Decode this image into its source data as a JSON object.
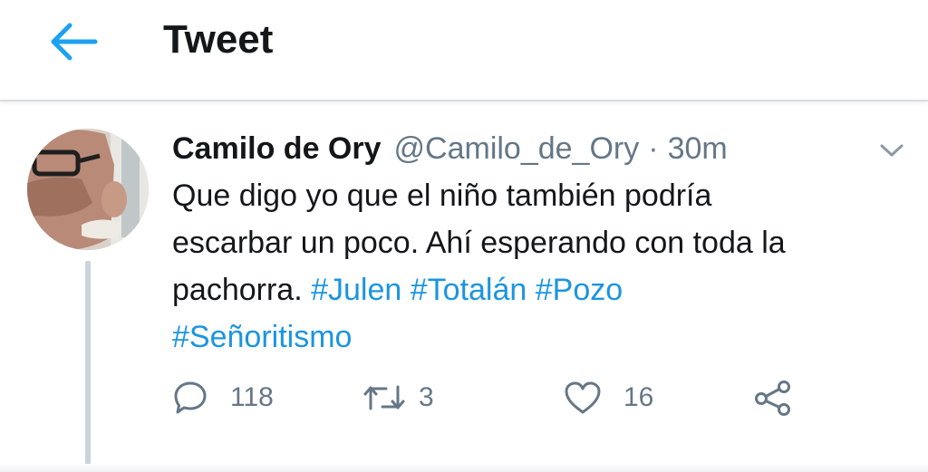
{
  "header": {
    "title": "Tweet",
    "back_icon": "arrow-left-icon",
    "accent": "#1da1f2"
  },
  "tweet": {
    "author_name": "Camilo de Ory",
    "author_handle": "@Camilo_de_Ory",
    "separator": "·",
    "timestamp": "30m",
    "caret_icon": "chevron-down-icon",
    "text_lines": [
      "Que digo yo que el niño también podría",
      "escarbar un poco. Ahí esperando con toda la",
      "pachorra."
    ],
    "hashtags": [
      "#Julen",
      "#Totalán",
      "#Pozo",
      "#Señoritismo"
    ],
    "hashtag_color": "#1b95e0",
    "actions": {
      "reply_count": "118",
      "retweet_count": "3",
      "like_count": "16",
      "reply_icon": "reply-icon",
      "retweet_icon": "retweet-icon",
      "like_icon": "heart-icon",
      "share_icon": "share-icon"
    }
  }
}
